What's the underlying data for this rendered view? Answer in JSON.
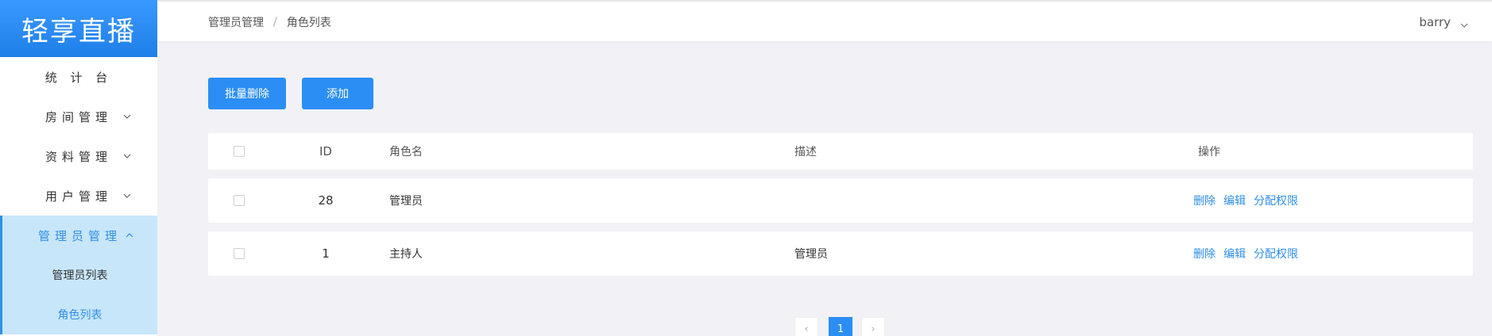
{
  "app": {
    "logo_text": "轻享直播"
  },
  "sidebar": {
    "items": [
      {
        "label": "统 计 台"
      },
      {
        "label": "房间管理"
      },
      {
        "label": "资料管理"
      },
      {
        "label": "用户管理"
      },
      {
        "label": "管理员管理"
      }
    ],
    "sub_items": [
      {
        "label": "管理员列表"
      },
      {
        "label": "角色列表"
      }
    ]
  },
  "header": {
    "breadcrumb": [
      "管理员管理",
      "角色列表"
    ],
    "breadcrumb_sep": "/",
    "user": "barry"
  },
  "toolbar": {
    "batch_delete": "批量删除",
    "add": "添加"
  },
  "table": {
    "headers": {
      "id": "ID",
      "name": "角色名",
      "desc": "描述",
      "ops": "操作"
    },
    "rows": [
      {
        "id": "28",
        "name": "管理员",
        "desc": ""
      },
      {
        "id": "1",
        "name": "主持人",
        "desc": "管理员"
      }
    ],
    "actions": {
      "delete": "删除",
      "edit": "编辑",
      "assign": "分配权限"
    }
  },
  "pagination": {
    "current": "1",
    "prev": "‹",
    "next": "›"
  },
  "colors": {
    "accent": "#2b8ef4",
    "active_bg": "#c8e6fa",
    "page_bg": "#f2f2f6"
  }
}
